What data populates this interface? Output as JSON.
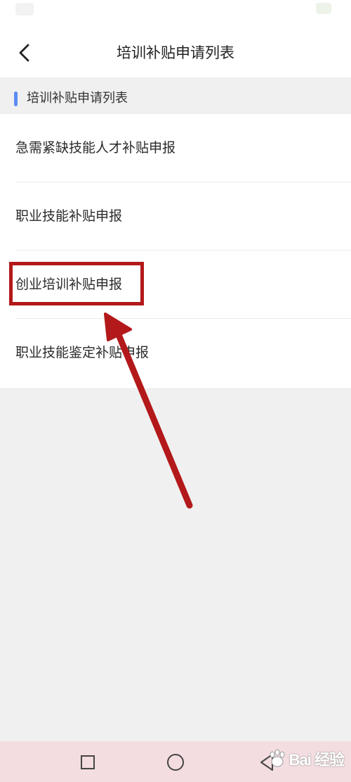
{
  "header": {
    "title": "培训补贴申请列表",
    "back_icon": "chevron-left-icon"
  },
  "section": {
    "title": "培训补贴申请列表",
    "accent_color": "#5b8df2"
  },
  "list": {
    "items": [
      {
        "label": "急需紧缺技能人才补贴申报"
      },
      {
        "label": "职业技能补贴申报"
      },
      {
        "label": "创业培训补贴申报",
        "highlighted": true
      },
      {
        "label": "职业技能鉴定补贴申报"
      }
    ]
  },
  "annotation": {
    "color": "#b3191a",
    "target": "创业培训补贴申报"
  },
  "nav": {
    "buttons": [
      "recent-apps-icon",
      "home-icon",
      "back-icon"
    ]
  },
  "watermark": {
    "text": "Bai 经验",
    "logo": "baidu-paw-logo"
  }
}
